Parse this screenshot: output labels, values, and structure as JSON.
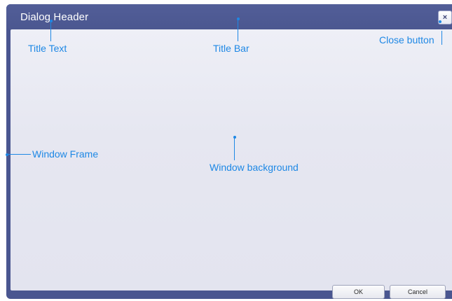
{
  "dialog": {
    "title": "Dialog Header",
    "close_symbol": "×",
    "buttons": {
      "ok_label": "OK",
      "cancel_label": "Cancel"
    }
  },
  "annotations": {
    "title_text": "Title Text",
    "title_bar": "Title Bar",
    "close_button": "Close button",
    "window_frame": "Window Frame",
    "window_background": "Window background"
  },
  "colors": {
    "frame": "#4a5690",
    "background": "#e6e7f1",
    "annotation": "#1e88e5"
  }
}
